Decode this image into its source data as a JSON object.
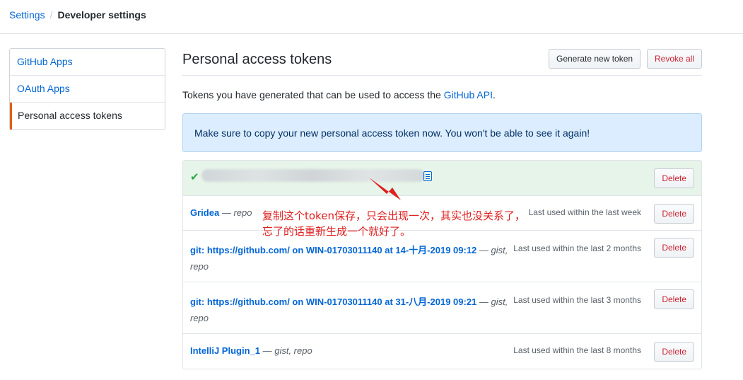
{
  "breadcrumb": {
    "settings": "Settings",
    "separator": "/",
    "current": "Developer settings"
  },
  "sidebar": {
    "items": [
      {
        "label": "GitHub Apps",
        "selected": false
      },
      {
        "label": "OAuth Apps",
        "selected": false
      },
      {
        "label": "Personal access tokens",
        "selected": true
      }
    ]
  },
  "main": {
    "title": "Personal access tokens",
    "generate_button": "Generate new token",
    "revoke_button": "Revoke all",
    "description_prefix": "Tokens you have generated that can be used to access the ",
    "description_link": "GitHub API",
    "description_suffix": ".",
    "flash": "Make sure to copy your new personal access token now. You won't be able to see it again!",
    "delete_label": "Delete",
    "new_token": {
      "check_icon": "check-icon",
      "copy_icon": "clipboard-icon"
    },
    "tokens": [
      {
        "name": "Gridea",
        "dash": "—",
        "scopes": "repo",
        "last_used": "Last used within the last week"
      },
      {
        "name": "git: https://github.com/ on WIN-01703011140 at 14-十月-2019 09:12",
        "dash": "—",
        "scopes": "gist,",
        "scopes_line2": "repo",
        "last_used": "Last used within the last 2 months"
      },
      {
        "name": "git: https://github.com/ on WIN-01703011140 at 31-八月-2019 09:21",
        "dash": "—",
        "scopes": "gist,",
        "scopes_line2": "repo",
        "last_used": "Last used within the last 3 months"
      },
      {
        "name": "IntelliJ Plugin_1",
        "dash": "—",
        "scopes": "gist, repo",
        "last_used": "Last used within the last 8 months"
      }
    ]
  },
  "annotation": {
    "line1": "复制这个token保存，只会出现一次，其实也没关系了，",
    "line2": "忘了的话重新生成一个就好了。",
    "color": "#e02020"
  },
  "colors": {
    "link": "#0366d6",
    "danger": "#cb2431",
    "success": "#28a745",
    "selected_border": "#e36209"
  }
}
